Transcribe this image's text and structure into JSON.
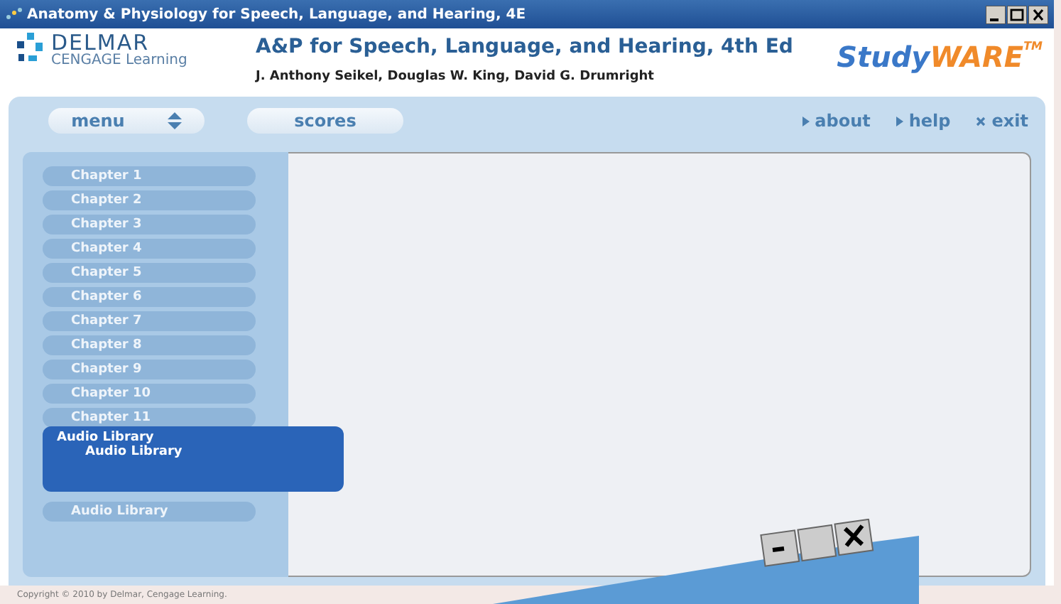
{
  "window": {
    "title": "Anatomy & Physiology for Speech, Language, and Hearing, 4E"
  },
  "header": {
    "logo_name": "DELMAR",
    "logo_sub": "CENGAGE Learning",
    "title": "A&P for Speech, Language, and Hearing, 4th Ed",
    "authors": "J. Anthony Seikel, Douglas W. King, David G. Drumright",
    "brand_part_1": "Study",
    "brand_part_2": "WARE",
    "brand_mark": "TM"
  },
  "toolbar": {
    "buttons": [
      {
        "label": "menu"
      },
      {
        "label": "scores"
      }
    ],
    "links": [
      {
        "label": "about",
        "kind": "arrow"
      },
      {
        "label": "help",
        "kind": "arrow"
      },
      {
        "label": "exit",
        "kind": "close"
      }
    ]
  },
  "sidebar": {
    "items": [
      {
        "label": "Chapter 1"
      },
      {
        "label": "Chapter 2"
      },
      {
        "label": "Chapter 3"
      },
      {
        "label": "Chapter 4"
      },
      {
        "label": "Chapter 5"
      },
      {
        "label": "Chapter 6"
      },
      {
        "label": "Chapter 7"
      },
      {
        "label": "Chapter 8"
      },
      {
        "label": "Chapter 9"
      },
      {
        "label": "Chapter 10"
      },
      {
        "label": "Chapter 11"
      }
    ],
    "popup": {
      "heading": "Audio Library",
      "items": [
        "Audio Library"
      ]
    },
    "last_item": "Audio Library"
  },
  "footer": {
    "copyright": "Copyright © 2010 by Delmar, Cengage Learning."
  }
}
